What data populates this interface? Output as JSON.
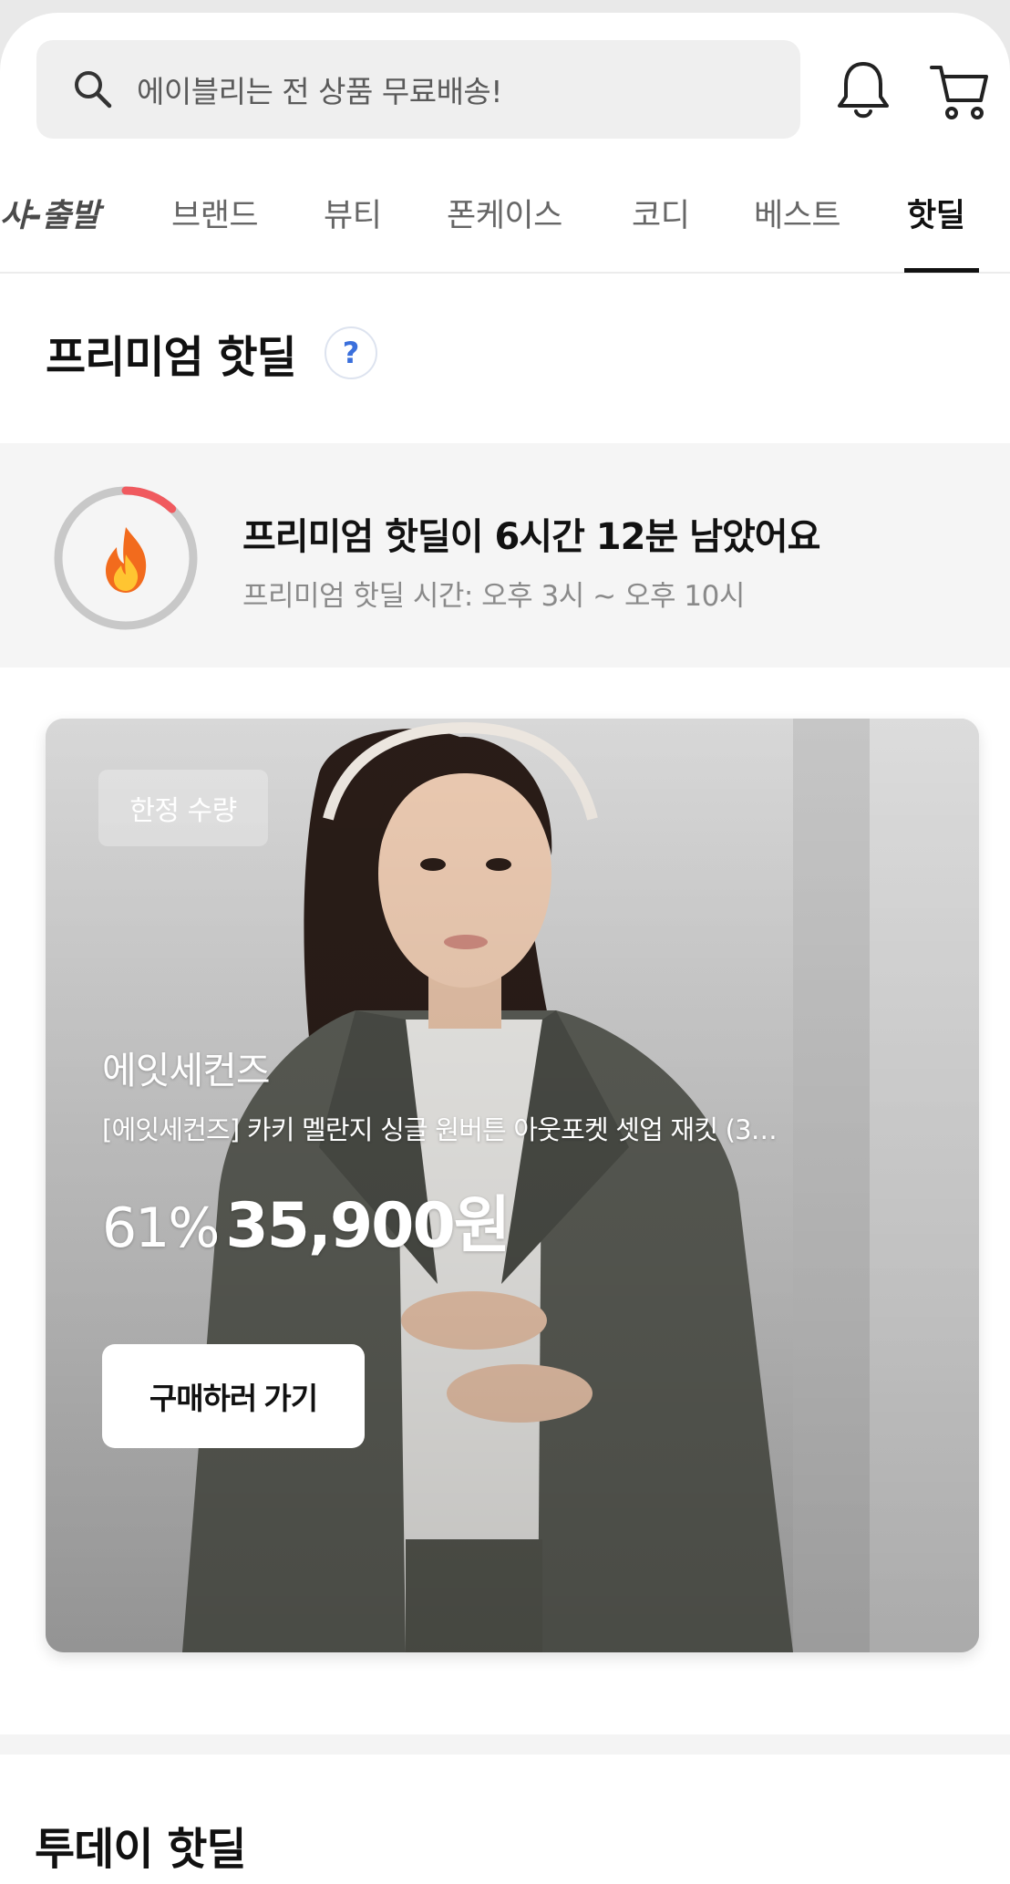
{
  "search": {
    "placeholder": "에이블리는 전 상품 무료배송!"
  },
  "header_icons": [
    "bell-icon",
    "cart-icon"
  ],
  "tabs": [
    {
      "label": "샤-출발",
      "active": false
    },
    {
      "label": "브랜드",
      "active": false
    },
    {
      "label": "뷰티",
      "active": false
    },
    {
      "label": "폰케이스",
      "active": false
    },
    {
      "label": "코디",
      "active": false
    },
    {
      "label": "베스트",
      "active": false
    },
    {
      "label": "핫딜",
      "active": true
    }
  ],
  "premium": {
    "title": "프리미엄 핫딜",
    "help_glyph": "?",
    "timer": {
      "main": "프리미엄 핫딜이 6시간 12분 남았어요",
      "sub": "프리미엄 핫딜 시간: 오후 3시 ~ 오후 10시",
      "remaining_fraction": 0.12,
      "icon": "fire-icon"
    }
  },
  "product": {
    "badge": "한정 수량",
    "brand": "에잇세컨즈",
    "name": "[에잇세컨즈] 카키 멜란지 싱글 원버튼 아웃포켓 셋업 재킷 (3…",
    "discount": "61%",
    "price": "35,900원",
    "cta": "구매하러 가기"
  },
  "today": {
    "title": "투데이 핫딜"
  },
  "colors": {
    "accent_red": "#f05a5f",
    "help_blue": "#3a6fdc",
    "ring_gray": "#c8c8c8"
  }
}
